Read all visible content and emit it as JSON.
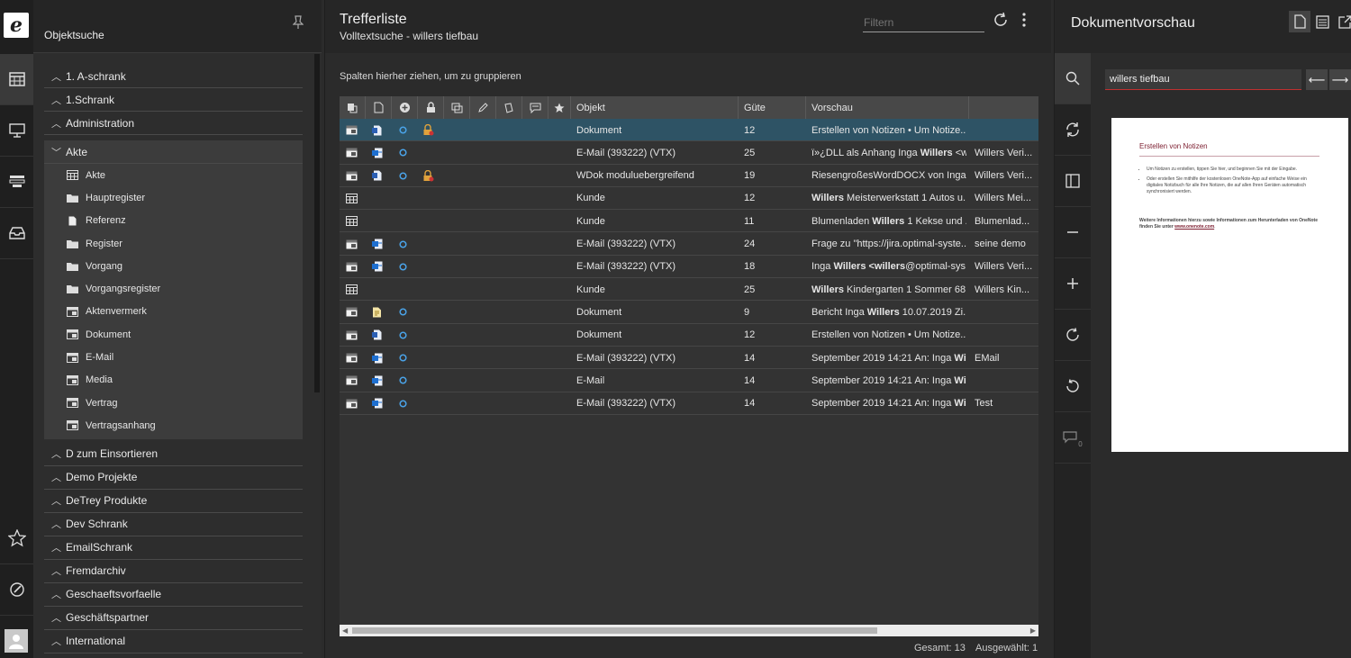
{
  "rail": {
    "logo": "e",
    "icons": [
      "table-icon",
      "monitor-icon",
      "stack-icon",
      "inbox-icon",
      "star-icon",
      "edit-circle-icon",
      "user-icon"
    ]
  },
  "objektsuche": {
    "title": "Objektsuche",
    "tree_top": [
      {
        "label": "1. A-schrank"
      },
      {
        "label": "1.Schrank"
      },
      {
        "label": "Administration"
      }
    ],
    "akte": {
      "label": "Akte",
      "children": [
        {
          "label": "Akte",
          "icon": "table-icon"
        },
        {
          "label": "Hauptregister",
          "icon": "folder-icon"
        },
        {
          "label": "Referenz",
          "icon": "document-icon"
        },
        {
          "label": "Register",
          "icon": "folder-icon"
        },
        {
          "label": "Vorgang",
          "icon": "folder-icon"
        },
        {
          "label": "Vorgangsregister",
          "icon": "folder-icon"
        },
        {
          "label": "Aktenvermerk",
          "icon": "form-icon"
        },
        {
          "label": "Dokument",
          "icon": "form-icon"
        },
        {
          "label": "E-Mail",
          "icon": "form-icon"
        },
        {
          "label": "Media",
          "icon": "form-icon"
        },
        {
          "label": "Vertrag",
          "icon": "form-icon"
        },
        {
          "label": "Vertragsanhang",
          "icon": "form-icon"
        }
      ]
    },
    "tree_bottom": [
      {
        "label": "D zum Einsortieren"
      },
      {
        "label": "Demo Projekte"
      },
      {
        "label": "DeTrey Produkte"
      },
      {
        "label": "Dev Schrank"
      },
      {
        "label": "EmailSchrank"
      },
      {
        "label": "Fremdarchiv"
      },
      {
        "label": "Geschaeftsvorfaelle"
      },
      {
        "label": "Geschäftspartner"
      },
      {
        "label": "International"
      }
    ]
  },
  "trefferliste": {
    "title": "Trefferliste",
    "subtitle": "Volltextsuche - willers tiefbau",
    "filter_placeholder": "Filtern",
    "group_hint": "Spalten hierher ziehen, um zu gruppieren",
    "columns": {
      "objekt": "Objekt",
      "guete": "Güte",
      "vorschau": "Vorschau"
    },
    "rows": [
      {
        "type": "form",
        "sub": "word",
        "status": true,
        "lock": true,
        "objekt": "Dokument",
        "guete": "12",
        "pre": "Erstellen von Notizen • Um Notize...",
        "pre_bold": "",
        "pre_after": "",
        "extra": ""
      },
      {
        "type": "form",
        "sub": "mail",
        "status": true,
        "lock": false,
        "objekt": "E-Mail (393222) (VTX)",
        "guete": "25",
        "pre": "ï»¿DLL als Anhang Inga ",
        "pre_bold": "Willers",
        "pre_after": " <w...",
        "extra": "Willers Veri..."
      },
      {
        "type": "form",
        "sub": "word",
        "status": true,
        "lock": true,
        "objekt": "WDok moduluebergreifend",
        "guete": "19",
        "pre": "RiesengroßesWordDOCX von Inga ...",
        "pre_bold": "",
        "pre_after": "",
        "extra": "Willers Veri..."
      },
      {
        "type": "table",
        "sub": "",
        "status": false,
        "lock": false,
        "objekt": "Kunde",
        "guete": "12",
        "pre": "",
        "pre_bold": "Willers",
        "pre_after": " Meisterwerkstatt 1 Autos u...",
        "extra": "Willers Mei..."
      },
      {
        "type": "table",
        "sub": "",
        "status": false,
        "lock": false,
        "objekt": "Kunde",
        "guete": "11",
        "pre": "Blumenladen ",
        "pre_bold": "Willers",
        "pre_after": " 1 Kekse und ...",
        "extra": "Blumenlad..."
      },
      {
        "type": "form",
        "sub": "mail",
        "status": true,
        "lock": false,
        "objekt": "E-Mail (393222) (VTX)",
        "guete": "24",
        "pre": "Frage zu \"https://jira.optimal-syste...",
        "pre_bold": "",
        "pre_after": "",
        "extra": "seine demo"
      },
      {
        "type": "form",
        "sub": "mail",
        "status": true,
        "lock": false,
        "objekt": "E-Mail (393222) (VTX)",
        "guete": "18",
        "pre": "Inga ",
        "pre_bold": "Willers <willers",
        "pre_after": "@optimal-sys...",
        "extra": "Willers Veri..."
      },
      {
        "type": "table",
        "sub": "",
        "status": false,
        "lock": false,
        "objekt": "Kunde",
        "guete": "25",
        "pre": "",
        "pre_bold": "Willers",
        "pre_after": " Kindergarten 1 Sommer 68...",
        "extra": "Willers Kin..."
      },
      {
        "type": "form",
        "sub": "note",
        "status": true,
        "lock": false,
        "objekt": "Dokument",
        "guete": "9",
        "pre": "Bericht Inga ",
        "pre_bold": "Willers",
        "pre_after": " 10.07.2019 Zi...",
        "extra": ""
      },
      {
        "type": "form",
        "sub": "word",
        "status": true,
        "lock": false,
        "objekt": "Dokument",
        "guete": "12",
        "pre": "Erstellen von Notizen • Um Notize...",
        "pre_bold": "",
        "pre_after": "",
        "extra": ""
      },
      {
        "type": "form",
        "sub": "mail",
        "status": true,
        "lock": false,
        "objekt": "E-Mail (393222) (VTX)",
        "guete": "14",
        "pre": "September 2019 14:21 An: Inga ",
        "pre_bold": "Wi...",
        "pre_after": "",
        "extra": "EMail"
      },
      {
        "type": "form",
        "sub": "mail",
        "status": true,
        "lock": false,
        "objekt": "E-Mail",
        "guete": "14",
        "pre": "September 2019 14:21 An: Inga ",
        "pre_bold": "Wi...",
        "pre_after": "",
        "extra": ""
      },
      {
        "type": "form",
        "sub": "mail",
        "status": true,
        "lock": false,
        "objekt": "E-Mail (393222) (VTX)",
        "guete": "14",
        "pre": "September 2019 14:21 An: Inga ",
        "pre_bold": "Wi...",
        "pre_after": "",
        "extra": "Test"
      }
    ],
    "gesamt": "Gesamt: 13",
    "ausgewaehlt": "Ausgewählt: 1"
  },
  "vorschau": {
    "title": "Dokumentvorschau",
    "search_value": "willers tiefbau",
    "comment_count": "0",
    "doc": {
      "heading": "Erstellen von Notizen",
      "bullet1": "Um Notizen zu erstellen, tippen Sie hier, und beginnen Sie mit der Eingabe.",
      "bullet2": "Oder erstellen Sie mithilfe der kostenlosen OneNote-App auf einfache Weise ein digitales Notizbuch für alle Ihre Notizen, die auf allen Ihren Geräten automatisch synchronisiert werden.",
      "para": "Weitere Informationen hierzu sowie Informationen zum Herunterladen von OneNote finden Sie unter",
      "link": "www.onenote.com"
    }
  },
  "colors": {
    "selection": "#2e5365",
    "accent_red": "#c03030",
    "mail_blue": "#3b7fd1",
    "lock_orange": "#e0a23c"
  }
}
